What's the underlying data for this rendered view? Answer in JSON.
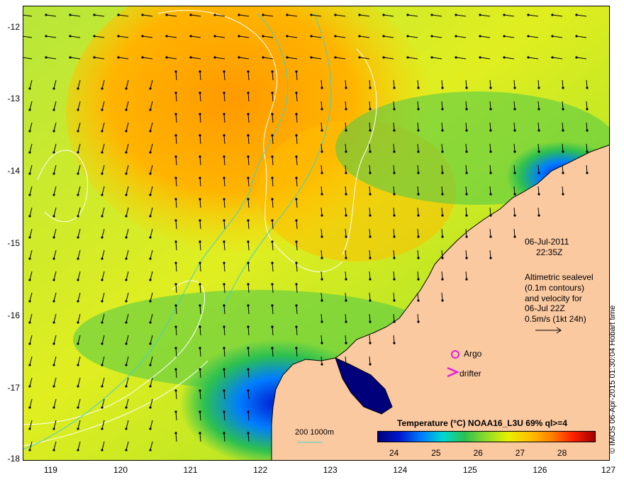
{
  "map": {
    "lon_range": [
      118.6,
      127.0
    ],
    "lat_range": [
      -18.0,
      -11.7
    ],
    "x_ticks": [
      119,
      120,
      121,
      122,
      123,
      124,
      125,
      126,
      127
    ],
    "y_ticks": [
      -12,
      -13,
      -14,
      -15,
      -16,
      -17,
      -18
    ],
    "x_tick_labels": [
      "119",
      "120",
      "121",
      "122",
      "123",
      "124",
      "125",
      "126",
      "127"
    ],
    "y_tick_labels": [
      "-12",
      "-13",
      "-14",
      "-15",
      "-16",
      "-17",
      "-18"
    ],
    "land_color": "#fbc9a0",
    "coast_color": "#000000",
    "contour_color": "#ffffff",
    "isobath_color": "#3fd1d1",
    "marker_color": "#e020e0"
  },
  "annotations": {
    "date": "06-Jul-2011",
    "time": "22:35Z",
    "alt_line1": "Altimetric sealevel",
    "alt_line2": "(0.1m contours)",
    "alt_line3": "and velocity for",
    "alt_line4": "06-Jul 22Z",
    "alt_line5": "0.5m/s (1kt 24h)",
    "argo_label": "Argo",
    "drifter_label": "drifter",
    "isobath_label": "200  1000m"
  },
  "colorbar": {
    "title": "Temperature (°C) NOAA16_L3U 69% ql>=4",
    "range": [
      23.6,
      28.8
    ],
    "tick_values": [
      24,
      25,
      26,
      27,
      28
    ],
    "tick_labels": [
      "24",
      "25",
      "26",
      "27",
      "28"
    ],
    "colors": [
      "#00007a",
      "#0018d0",
      "#007dff",
      "#00d8d0",
      "#2cc050",
      "#8fdc2a",
      "#e8f000",
      "#ffc000",
      "#ff8000",
      "#ff2000",
      "#a00000"
    ]
  },
  "credit": "© IMOS 06-Apr-2015 01:30:04 Hobart time"
}
